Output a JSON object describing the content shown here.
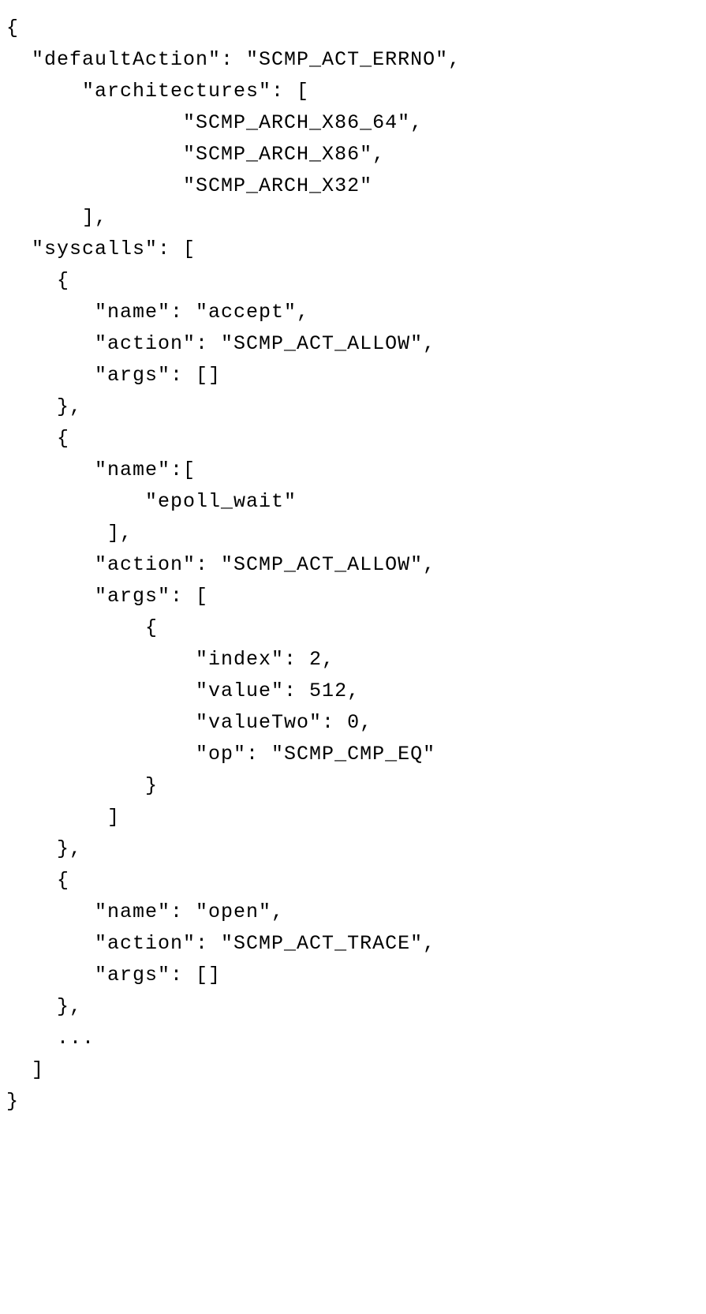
{
  "lines": [
    "{",
    "  \"defaultAction\": \"SCMP_ACT_ERRNO\",",
    "      \"architectures\": [",
    "              \"SCMP_ARCH_X86_64\",",
    "              \"SCMP_ARCH_X86\",",
    "              \"SCMP_ARCH_X32\"",
    "      ],",
    "  \"syscalls\": [",
    "    {",
    "       \"name\": \"accept\",",
    "       \"action\": \"SCMP_ACT_ALLOW\",",
    "       \"args\": []",
    "    },",
    "    {",
    "       \"name\":[",
    "           \"epoll_wait\"",
    "        ],",
    "       \"action\": \"SCMP_ACT_ALLOW\",",
    "       \"args\": [",
    "           {",
    "               \"index\": 2,",
    "               \"value\": 512,",
    "               \"valueTwo\": 0,",
    "               \"op\": \"SCMP_CMP_EQ\"",
    "           }",
    "        ]",
    "    },",
    "    {",
    "       \"name\": \"open\",",
    "       \"action\": \"SCMP_ACT_TRACE\",",
    "       \"args\": []",
    "    },",
    "    ...",
    "  ]",
    "}"
  ]
}
